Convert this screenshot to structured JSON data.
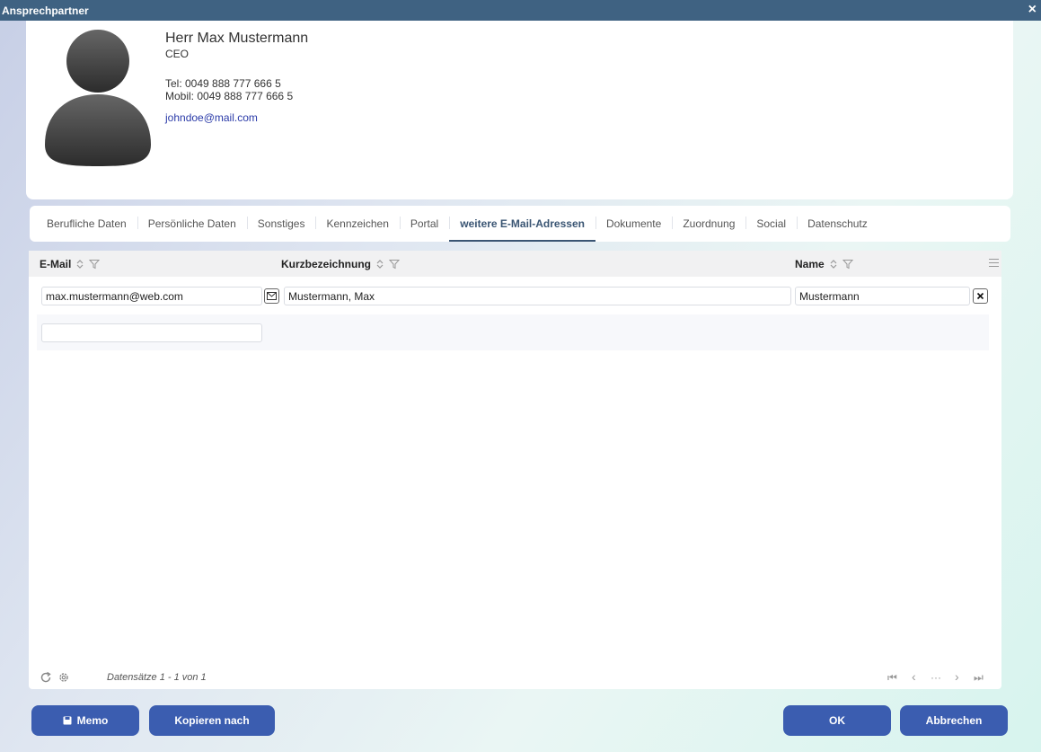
{
  "window": {
    "title": "Ansprechpartner",
    "close_label": "×"
  },
  "contact": {
    "name": "Herr Max Mustermann",
    "role": "CEO",
    "tel": "Tel: 0049 888 777 666 5",
    "mobil": "Mobil: 0049 888 777 666 5",
    "email": "johndoe@mail.com"
  },
  "tabs": [
    {
      "label": "Berufliche Daten"
    },
    {
      "label": "Persönliche Daten"
    },
    {
      "label": "Sonstiges"
    },
    {
      "label": "Kennzeichen"
    },
    {
      "label": "Portal"
    },
    {
      "label": "weitere E-Mail-Adressen",
      "active": true
    },
    {
      "label": "Dokumente"
    },
    {
      "label": "Zuordnung"
    },
    {
      "label": "Social"
    },
    {
      "label": "Datenschutz"
    }
  ],
  "grid": {
    "columns": {
      "email": "E-Mail",
      "kurz": "Kurzbezeichnung",
      "name": "Name"
    },
    "rows": [
      {
        "email": "max.mustermann@web.com",
        "kurz": "Mustermann, Max",
        "name": "Mustermann"
      }
    ],
    "new_row": {
      "email": ""
    },
    "status": "Datensätze 1 - 1 von 1",
    "pager": {
      "first": "⏮",
      "prev": "‹",
      "more": "···",
      "next": "›",
      "last": "⏭"
    }
  },
  "buttons": {
    "memo": "Memo",
    "copy": "Kopieren nach",
    "ok": "OK",
    "cancel": "Abbrechen"
  },
  "colors": {
    "titlebar": "#3f6282",
    "primary_button": "#3b5db0",
    "active_tab": "#3a5573",
    "link": "#2a3aa8"
  },
  "icons": {
    "avatar": "person-silhouette-icon",
    "mail_action": "envelope-icon",
    "delete_row": "close-box-icon",
    "refresh": "refresh-icon",
    "settings": "gear-icon",
    "memo": "floppy-disk-icon",
    "column_menu": "menu-icon"
  }
}
